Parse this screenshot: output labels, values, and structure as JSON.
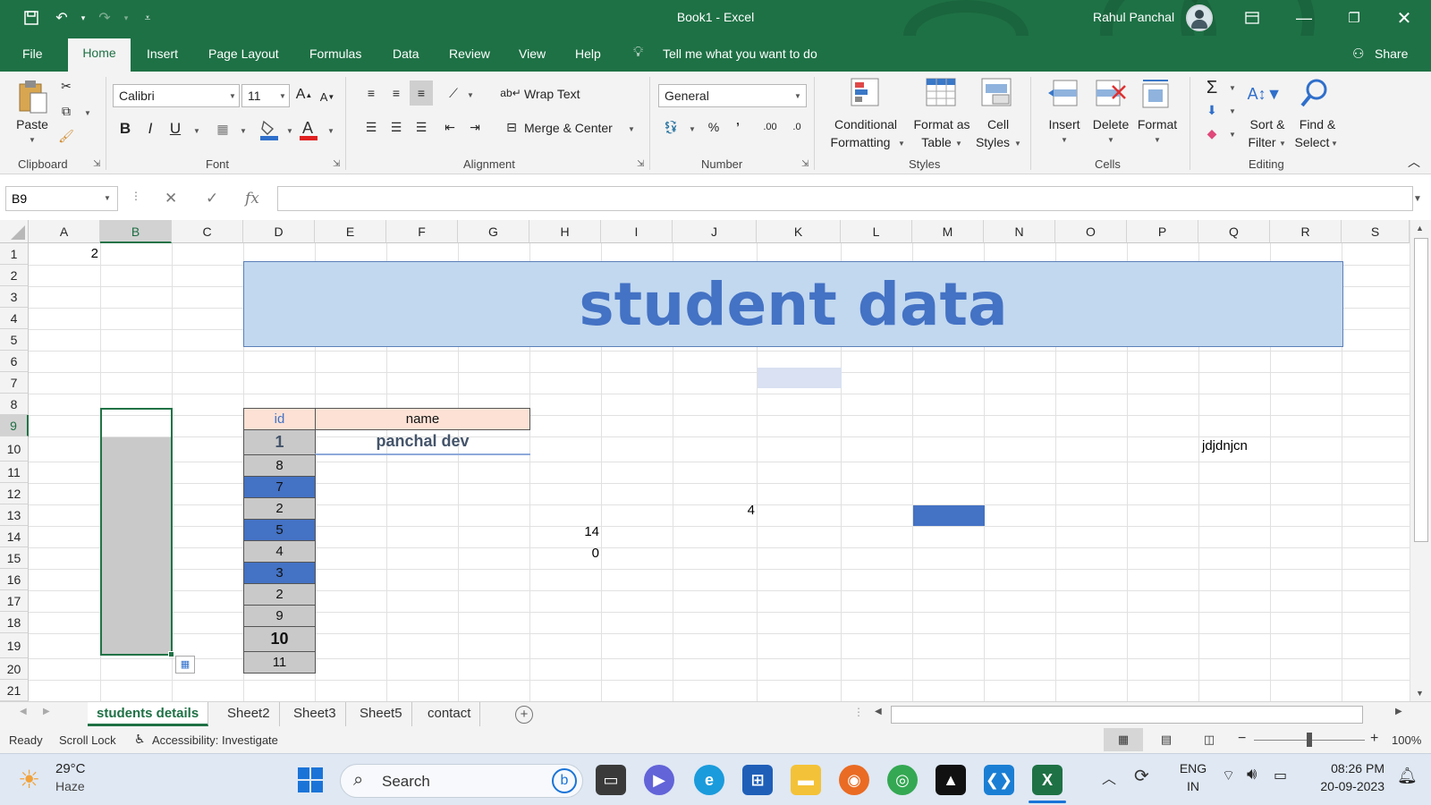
{
  "window": {
    "title": "Book1  -  Excel",
    "user": "Rahul Panchal",
    "colors": {
      "accent": "#1e7145",
      "banner_fill": "#c2d8ef",
      "banner_text": "#4472c4",
      "header_fill": "#fde1d5",
      "blue_fill": "#4472c4",
      "gray_fill": "#c9c9c9"
    }
  },
  "menu": {
    "tabs": [
      "File",
      "Home",
      "Insert",
      "Page Layout",
      "Formulas",
      "Data",
      "Review",
      "View",
      "Help"
    ],
    "tell_me": "Tell me what you want to do",
    "share": "Share"
  },
  "ribbon": {
    "clipboard": {
      "label": "Clipboard",
      "paste": "Paste"
    },
    "font": {
      "label": "Font",
      "font_name": "Calibri",
      "font_size": "11",
      "bold": "B",
      "italic": "I",
      "underline": "U"
    },
    "alignment": {
      "label": "Alignment",
      "wrap_text": "Wrap Text",
      "merge_center": "Merge & Center"
    },
    "number": {
      "label": "Number",
      "format": "General",
      "percent": "%",
      "comma": "ʼ",
      "inc_dec": ".00",
      "dec_dec": ".0"
    },
    "styles": {
      "label": "Styles",
      "conditional_1": "Conditional",
      "conditional_2": "Formatting",
      "format_table_1": "Format as",
      "format_table_2": "Table",
      "cell_styles_1": "Cell",
      "cell_styles_2": "Styles"
    },
    "cells": {
      "label": "Cells",
      "insert": "Insert",
      "delete": "Delete",
      "format": "Format"
    },
    "editing": {
      "label": "Editing",
      "sort_1": "Sort &",
      "sort_2": "Filter",
      "find_1": "Find &",
      "find_2": "Select"
    }
  },
  "formula_bar": {
    "name_box": "B9",
    "fx": "fx",
    "formula": ""
  },
  "grid": {
    "columns": [
      "A",
      "B",
      "C",
      "D",
      "E",
      "F",
      "G",
      "H",
      "I",
      "J",
      "K",
      "L",
      "M",
      "N",
      "O",
      "P",
      "Q",
      "R",
      "S"
    ],
    "rows": [
      "1",
      "2",
      "3",
      "4",
      "5",
      "6",
      "7",
      "8",
      "9",
      "10",
      "11",
      "12",
      "13",
      "14",
      "15",
      "16",
      "17",
      "18",
      "19",
      "20",
      "21"
    ],
    "selected_column": "B",
    "selected_row": "9",
    "banner_text": "student data",
    "table_header": {
      "id": "id",
      "name": "name"
    },
    "first_row": {
      "id": "1",
      "name": "panchal dev"
    },
    "ids": [
      "8",
      "7",
      "2",
      "5",
      "4",
      "3",
      "2",
      "9",
      "10",
      "11"
    ],
    "cells": {
      "A1": "2",
      "J13": "4",
      "H14": "14",
      "H15": "0",
      "Q10": "jdjdnjcn"
    }
  },
  "sheets": {
    "tabs": [
      "students details",
      "Sheet2",
      "Sheet3",
      "Sheet5",
      "contact"
    ],
    "active": "students details"
  },
  "status": {
    "ready": "Ready",
    "scroll_lock": "Scroll Lock",
    "accessibility": "Accessibility: Investigate",
    "zoom": "100%"
  },
  "taskbar": {
    "weather_temp": "29°C",
    "weather_desc": "Haze",
    "search": "Search",
    "lang_1": "ENG",
    "lang_2": "IN",
    "time": "08:26 PM",
    "date": "20-09-2023"
  }
}
